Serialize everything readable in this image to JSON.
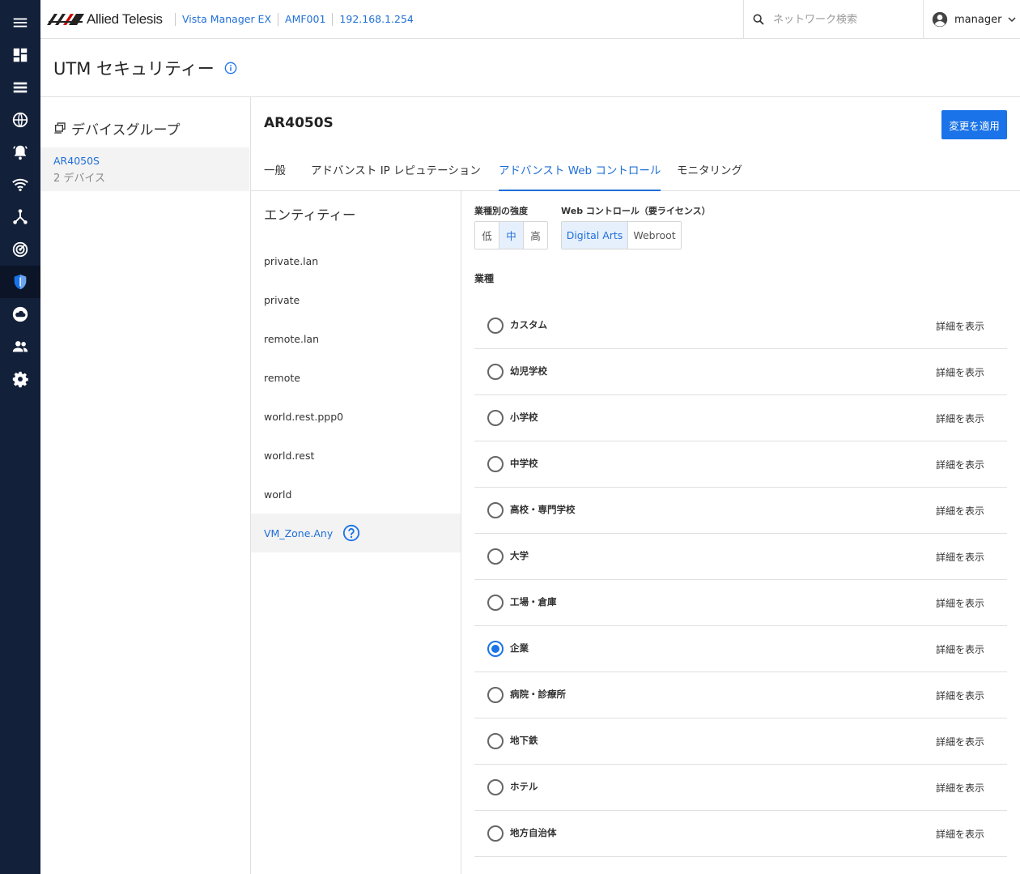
{
  "header": {
    "brand": "Allied Telesis",
    "breadcrumbs": [
      "Vista Manager EX",
      "AMF001",
      "192.168.1.254"
    ],
    "search_placeholder": "ネットワーク検索",
    "user": "manager"
  },
  "page": {
    "title": "UTM セキュリティー"
  },
  "device_group": {
    "heading": "デバイスグループ",
    "selected": {
      "name": "AR4050S",
      "count": "2 デバイス"
    }
  },
  "device": {
    "name": "AR4050S",
    "apply_label": "変更を適用"
  },
  "tabs": [
    {
      "label": "一般"
    },
    {
      "label": "アドバンスト IP レピュテーション"
    },
    {
      "label": "アドバンスト Web コントロール",
      "active": true
    },
    {
      "label": "モニタリング"
    }
  ],
  "entities": {
    "heading": "エンティティー",
    "items": [
      {
        "label": "private.lan"
      },
      {
        "label": "private"
      },
      {
        "label": "remote.lan"
      },
      {
        "label": "remote"
      },
      {
        "label": "world.rest.ppp0"
      },
      {
        "label": "world.rest"
      },
      {
        "label": "world"
      },
      {
        "label": "VM_Zone.Any",
        "active": true
      }
    ]
  },
  "strength": {
    "label": "業種別の強度",
    "options": [
      {
        "label": "低"
      },
      {
        "label": "中",
        "active": true
      },
      {
        "label": "高"
      }
    ]
  },
  "web_control": {
    "label": "Web コントロール（要ライセンス）",
    "options": [
      {
        "label": "Digital Arts",
        "active": true
      },
      {
        "label": "Webroot"
      }
    ]
  },
  "industry": {
    "label": "業種",
    "detail_label": "詳細を表示",
    "items": [
      {
        "label": "カスタム",
        "checked": false
      },
      {
        "label": "幼児学校",
        "checked": false
      },
      {
        "label": "小学校",
        "checked": false
      },
      {
        "label": "中学校",
        "checked": false
      },
      {
        "label": "高校・専門学校",
        "checked": false
      },
      {
        "label": "大学",
        "checked": false
      },
      {
        "label": "工場・倉庫",
        "checked": false
      },
      {
        "label": "企業",
        "checked": true
      },
      {
        "label": "病院・診療所",
        "checked": false
      },
      {
        "label": "地下鉄",
        "checked": false
      },
      {
        "label": "ホテル",
        "checked": false
      },
      {
        "label": "地方自治体",
        "checked": false
      }
    ]
  },
  "colors": {
    "accent": "#1a73e8",
    "rail": "#13203a",
    "link": "#1f6fd8"
  },
  "sidebar_icons": [
    "menu-icon",
    "dashboard-icon",
    "list-icon",
    "globe-icon",
    "alarm-icon",
    "wifi-icon",
    "topology-icon",
    "radar-icon",
    "shield-icon",
    "cloud-icon",
    "users-icon",
    "gear-icon"
  ]
}
